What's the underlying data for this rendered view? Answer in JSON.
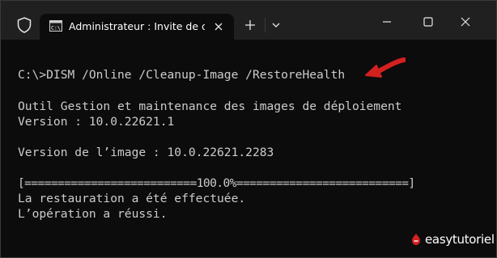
{
  "window": {
    "tab_title": "Administrateur : Invite de commandes",
    "controls": [
      "minimize-icon",
      "maximize-icon",
      "close-icon"
    ]
  },
  "terminal": {
    "lines": [
      "C:\\>DISM /Online /Cleanup-Image /RestoreHealth",
      "Outil Gestion et maintenance des images de déploiement",
      "Version : 10.0.22621.1",
      "Version de l’image : 10.0.22621.2283",
      "[==========================100.0%==========================]",
      "La restauration a été effectuée.",
      "L’opération a réussi."
    ]
  },
  "watermark": {
    "text": "easytutoriel"
  },
  "colors": {
    "titlebar": "#202020",
    "background": "#0c0c0c",
    "text": "#cccccc",
    "arrow": "#d32020"
  }
}
